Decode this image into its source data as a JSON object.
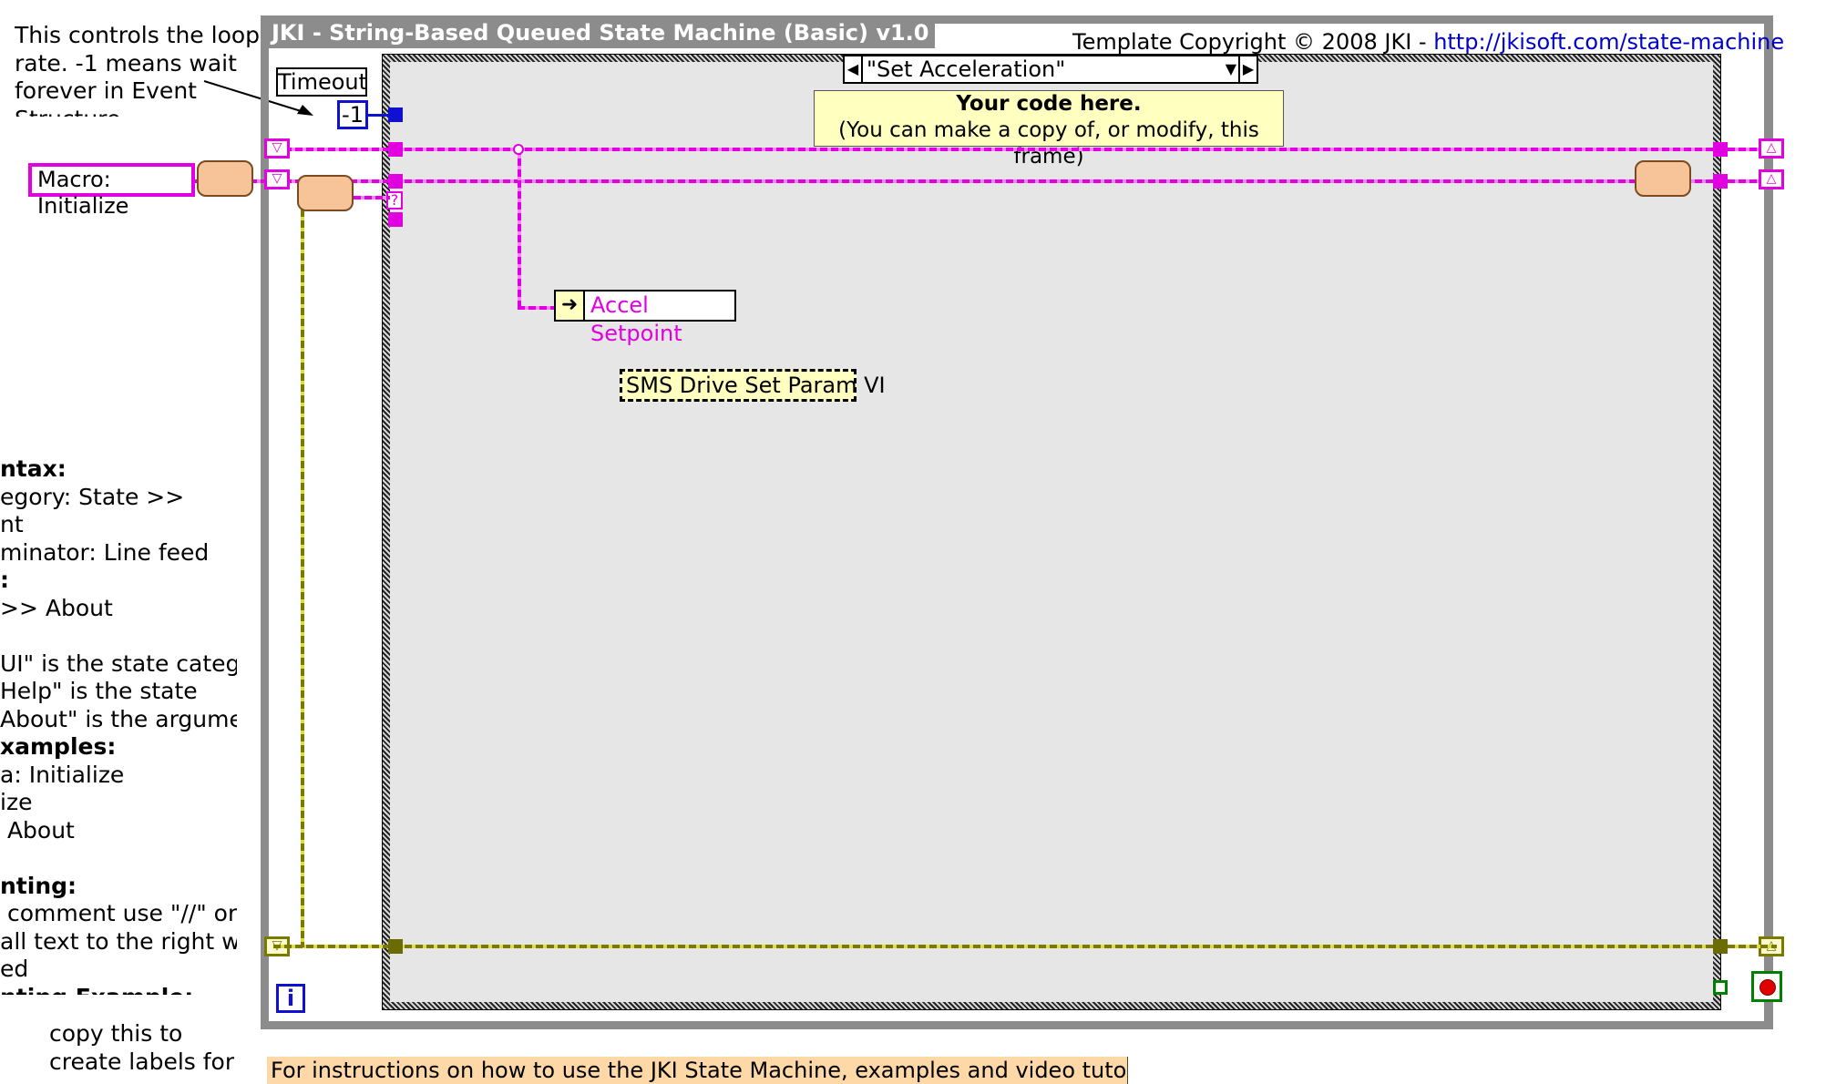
{
  "window": {
    "loop_title": "JKI - String-Based Queued State Machine (Basic) v1.0",
    "copyright_prefix": "Template Copyright © 2008 JKI - ",
    "copyright_link": "http://jkisoft.com/state-machine"
  },
  "left_notes": {
    "loop_rate": "This controls the loop\nrate. -1 means wait\nforever in Event\nStructure",
    "syntax": [
      {
        "text": "ntax:",
        "bold": true
      },
      {
        "text": "egory: State >>",
        "bold": false
      },
      {
        "text": "nt",
        "bold": false
      },
      {
        "text": "minator: Line feed",
        "bold": false
      },
      {
        "text": ":",
        "bold": true
      },
      {
        "text": ">> About",
        "bold": false
      },
      {
        "text": "",
        "bold": false
      },
      {
        "text": "UI\" is the state category",
        "bold": false
      },
      {
        "text": "Help\" is the state",
        "bold": false
      },
      {
        "text": "About\" is the argument",
        "bold": false
      },
      {
        "text": "xamples:",
        "bold": true
      },
      {
        "text": "a: Initialize",
        "bold": false
      },
      {
        "text": "ize",
        "bold": false
      },
      {
        "text": " About",
        "bold": false
      },
      {
        "text": "",
        "bold": false
      },
      {
        "text": "nting:",
        "bold": true
      },
      {
        "text": " comment use \"//\" or",
        "bold": false
      },
      {
        "text": "all text to the right will",
        "bold": false
      },
      {
        "text": "ed",
        "bold": false
      },
      {
        "text": "nting Example:",
        "bold": true
      }
    ],
    "copy_note": "copy this to\ncreate labels for"
  },
  "diagram": {
    "timeout_label": "Timeout",
    "timeout_value": "-1",
    "macro_constant": "Macro: Initialize",
    "case_selector": "\"Set Acceleration\"",
    "code_note_title": "Your code here.",
    "code_note_body": "(You can make a copy of, or modify, this frame)",
    "accel_indicator": "Accel Setpoint",
    "sms_label": "SMS Drive Set Param VI",
    "iteration_terminal": "i",
    "shift_question": "?"
  },
  "footer": {
    "instructions": "For instructions on how to use the JKI State Machine, examples and video tutorials, visit:"
  },
  "colors": {
    "string_wire": "#e000e0",
    "error_wire": "#7a7a00",
    "numeric_blue": "#1010d0",
    "loop_border": "#8c8c8c"
  }
}
